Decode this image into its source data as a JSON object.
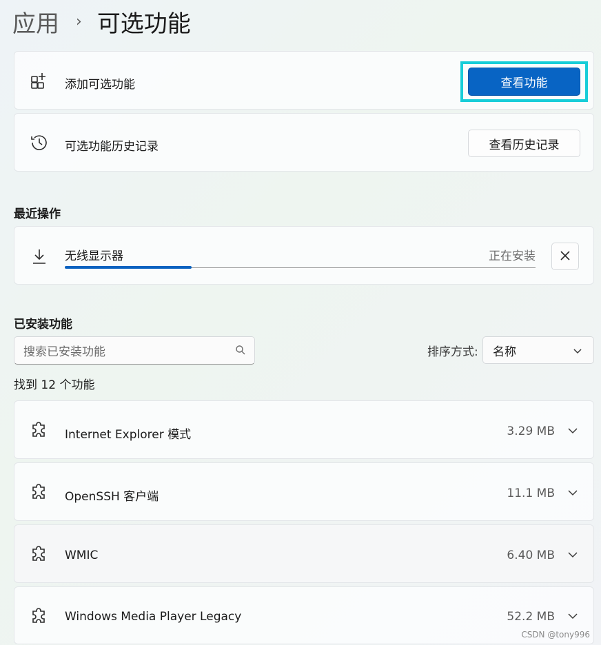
{
  "breadcrumb": {
    "parent": "应用",
    "separator": "›",
    "current": "可选功能"
  },
  "add_feature": {
    "icon": "add-grid-icon",
    "label": "添加可选功能",
    "button": "查看功能"
  },
  "history": {
    "icon": "history-icon",
    "label": "可选功能历史记录",
    "button": "查看历史记录"
  },
  "recent": {
    "title": "最近操作",
    "item": {
      "icon": "download-icon",
      "name": "无线显示器",
      "status": "正在安装",
      "progress": 0.27,
      "close_icon": "close-icon"
    }
  },
  "installed": {
    "title": "已安装功能",
    "search_placeholder": "搜索已安装功能",
    "sort_label": "排序方式:",
    "sort_value": "名称",
    "found_text": "找到 12 个功能",
    "features": [
      {
        "name": "Internet Explorer 模式",
        "size": "3.29 MB"
      },
      {
        "name": "OpenSSH 客户端",
        "size": "11.1 MB"
      },
      {
        "name": "WMIC",
        "size": "6.40 MB"
      },
      {
        "name": "Windows Media Player Legacy",
        "size": "52.2 MB"
      }
    ]
  },
  "colors": {
    "accent": "#0864c4",
    "highlight": "#18cdd8"
  },
  "watermark": "CSDN @tony996"
}
